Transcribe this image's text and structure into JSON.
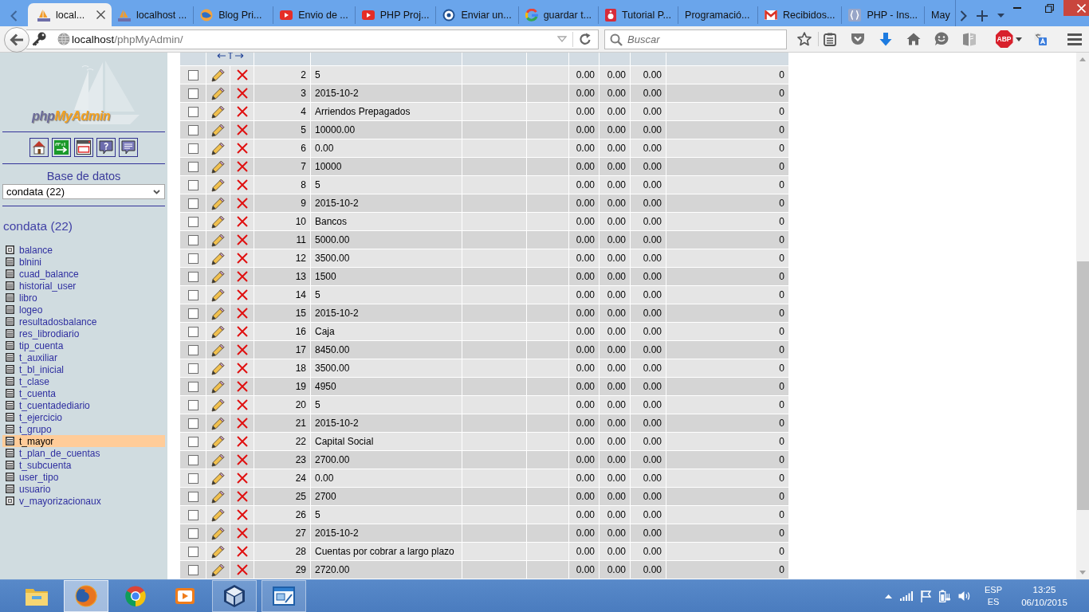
{
  "browser": {
    "tabs": [
      {
        "label": "local...",
        "selected": true
      },
      {
        "label": "localhost ...",
        "selected": false
      },
      {
        "label": "Blog Pri...",
        "selected": false
      },
      {
        "label": "Envio de ...",
        "selected": false
      },
      {
        "label": "PHP Proj...",
        "selected": false
      },
      {
        "label": "Enviar un...",
        "selected": false
      },
      {
        "label": "guardar t...",
        "selected": false
      },
      {
        "label": "Tutorial P...",
        "selected": false
      },
      {
        "label": "Programació...",
        "selected": false
      },
      {
        "label": "Recibidos...",
        "selected": false
      },
      {
        "label": "PHP - Ins...",
        "selected": false
      },
      {
        "label": "May",
        "selected": false
      }
    ]
  },
  "address_bar": {
    "host": "localhost",
    "path": "/phpMyAdmin/"
  },
  "search": {
    "placeholder": "Buscar"
  },
  "toolbar": {
    "adblock_label": "ABP"
  },
  "sidebar": {
    "logo": [
      "php",
      "MyAdmin"
    ],
    "database_label": "Base de datos",
    "database_select": {
      "value": "condata (22)"
    },
    "database_link": "condata (22)",
    "tables": [
      {
        "label": "balance",
        "kind": "view",
        "selected": false
      },
      {
        "label": "blnini",
        "kind": "table",
        "selected": false
      },
      {
        "label": "cuad_balance",
        "kind": "table",
        "selected": false
      },
      {
        "label": "historial_user",
        "kind": "table",
        "selected": false
      },
      {
        "label": "libro",
        "kind": "table",
        "selected": false
      },
      {
        "label": "logeo",
        "kind": "table",
        "selected": false
      },
      {
        "label": "resultadosbalance",
        "kind": "table",
        "selected": false
      },
      {
        "label": "res_librodiario",
        "kind": "table",
        "selected": false
      },
      {
        "label": "tip_cuenta",
        "kind": "table",
        "selected": false
      },
      {
        "label": "t_auxiliar",
        "kind": "table",
        "selected": false
      },
      {
        "label": "t_bl_inicial",
        "kind": "table",
        "selected": false
      },
      {
        "label": "t_clase",
        "kind": "table",
        "selected": false
      },
      {
        "label": "t_cuenta",
        "kind": "table",
        "selected": false
      },
      {
        "label": "t_cuentadediario",
        "kind": "table",
        "selected": false
      },
      {
        "label": "t_ejercicio",
        "kind": "table",
        "selected": false
      },
      {
        "label": "t_grupo",
        "kind": "table",
        "selected": false
      },
      {
        "label": "t_mayor",
        "kind": "table",
        "selected": true
      },
      {
        "label": "t_plan_de_cuentas",
        "kind": "table",
        "selected": false
      },
      {
        "label": "t_subcuenta",
        "kind": "table",
        "selected": false
      },
      {
        "label": "user_tipo",
        "kind": "table",
        "selected": false
      },
      {
        "label": "usuario",
        "kind": "table",
        "selected": false
      },
      {
        "label": "v_mayorizacionaux",
        "kind": "view",
        "selected": false
      }
    ]
  },
  "table": {
    "rows": [
      {
        "column_1": "2",
        "column_2": "5",
        "column_5": "0.00",
        "column_6": "0.00",
        "column_7": "0.00",
        "column_8": "0",
        "checked": false
      },
      {
        "column_1": "3",
        "column_2": "2015-10-2",
        "column_5": "0.00",
        "column_6": "0.00",
        "column_7": "0.00",
        "column_8": "0",
        "checked": false
      },
      {
        "column_1": "4",
        "column_2": "Arriendos Prepagados",
        "column_5": "0.00",
        "column_6": "0.00",
        "column_7": "0.00",
        "column_8": "0",
        "checked": false
      },
      {
        "column_1": "5",
        "column_2": "10000.00",
        "column_5": "0.00",
        "column_6": "0.00",
        "column_7": "0.00",
        "column_8": "0",
        "checked": false
      },
      {
        "column_1": "6",
        "column_2": "0.00",
        "column_5": "0.00",
        "column_6": "0.00",
        "column_7": "0.00",
        "column_8": "0",
        "checked": false
      },
      {
        "column_1": "7",
        "column_2": "10000",
        "column_5": "0.00",
        "column_6": "0.00",
        "column_7": "0.00",
        "column_8": "0",
        "checked": false
      },
      {
        "column_1": "8",
        "column_2": "5",
        "column_5": "0.00",
        "column_6": "0.00",
        "column_7": "0.00",
        "column_8": "0",
        "checked": false
      },
      {
        "column_1": "9",
        "column_2": "2015-10-2",
        "column_5": "0.00",
        "column_6": "0.00",
        "column_7": "0.00",
        "column_8": "0",
        "checked": false
      },
      {
        "column_1": "10",
        "column_2": "Bancos",
        "column_5": "0.00",
        "column_6": "0.00",
        "column_7": "0.00",
        "column_8": "0",
        "checked": false
      },
      {
        "column_1": "11",
        "column_2": "5000.00",
        "column_5": "0.00",
        "column_6": "0.00",
        "column_7": "0.00",
        "column_8": "0",
        "checked": false
      },
      {
        "column_1": "12",
        "column_2": "3500.00",
        "column_5": "0.00",
        "column_6": "0.00",
        "column_7": "0.00",
        "column_8": "0",
        "checked": false
      },
      {
        "column_1": "13",
        "column_2": "1500",
        "column_5": "0.00",
        "column_6": "0.00",
        "column_7": "0.00",
        "column_8": "0",
        "checked": false
      },
      {
        "column_1": "14",
        "column_2": "5",
        "column_5": "0.00",
        "column_6": "0.00",
        "column_7": "0.00",
        "column_8": "0",
        "checked": false
      },
      {
        "column_1": "15",
        "column_2": "2015-10-2",
        "column_5": "0.00",
        "column_6": "0.00",
        "column_7": "0.00",
        "column_8": "0",
        "checked": false
      },
      {
        "column_1": "16",
        "column_2": "Caja",
        "column_5": "0.00",
        "column_6": "0.00",
        "column_7": "0.00",
        "column_8": "0",
        "checked": false
      },
      {
        "column_1": "17",
        "column_2": "8450.00",
        "column_5": "0.00",
        "column_6": "0.00",
        "column_7": "0.00",
        "column_8": "0",
        "checked": false
      },
      {
        "column_1": "18",
        "column_2": "3500.00",
        "column_5": "0.00",
        "column_6": "0.00",
        "column_7": "0.00",
        "column_8": "0",
        "checked": false
      },
      {
        "column_1": "19",
        "column_2": "4950",
        "column_5": "0.00",
        "column_6": "0.00",
        "column_7": "0.00",
        "column_8": "0",
        "checked": false
      },
      {
        "column_1": "20",
        "column_2": "5",
        "column_5": "0.00",
        "column_6": "0.00",
        "column_7": "0.00",
        "column_8": "0",
        "checked": false
      },
      {
        "column_1": "21",
        "column_2": "2015-10-2",
        "column_5": "0.00",
        "column_6": "0.00",
        "column_7": "0.00",
        "column_8": "0",
        "checked": false
      },
      {
        "column_1": "22",
        "column_2": "Capital Social",
        "column_5": "0.00",
        "column_6": "0.00",
        "column_7": "0.00",
        "column_8": "0",
        "checked": false
      },
      {
        "column_1": "23",
        "column_2": "2700.00",
        "column_5": "0.00",
        "column_6": "0.00",
        "column_7": "0.00",
        "column_8": "0",
        "checked": false
      },
      {
        "column_1": "24",
        "column_2": "0.00",
        "column_5": "0.00",
        "column_6": "0.00",
        "column_7": "0.00",
        "column_8": "0",
        "checked": false
      },
      {
        "column_1": "25",
        "column_2": "2700",
        "column_5": "0.00",
        "column_6": "0.00",
        "column_7": "0.00",
        "column_8": "0",
        "checked": false
      },
      {
        "column_1": "26",
        "column_2": "5",
        "column_5": "0.00",
        "column_6": "0.00",
        "column_7": "0.00",
        "column_8": "0",
        "checked": false
      },
      {
        "column_1": "27",
        "column_2": "2015-10-2",
        "column_5": "0.00",
        "column_6": "0.00",
        "column_7": "0.00",
        "column_8": "0",
        "checked": false
      },
      {
        "column_1": "28",
        "column_2": "Cuentas por cobrar a largo plazo",
        "column_5": "0.00",
        "column_6": "0.00",
        "column_7": "0.00",
        "column_8": "0",
        "checked": false
      },
      {
        "column_1": "29",
        "column_2": "2720.00",
        "column_5": "0.00",
        "column_6": "0.00",
        "column_7": "0.00",
        "column_8": "0",
        "checked": false
      }
    ]
  },
  "taskbar": {
    "apps": [
      {
        "running": false,
        "selected": false
      },
      {
        "running": true,
        "selected": true
      },
      {
        "running": false,
        "selected": false
      },
      {
        "running": false,
        "selected": false
      },
      {
        "running": true,
        "selected": false
      },
      {
        "running": true,
        "selected": false
      }
    ],
    "tray": {
      "language": "ESP",
      "layout": "ES",
      "time": "13:25",
      "date": "06/10/2015"
    }
  }
}
